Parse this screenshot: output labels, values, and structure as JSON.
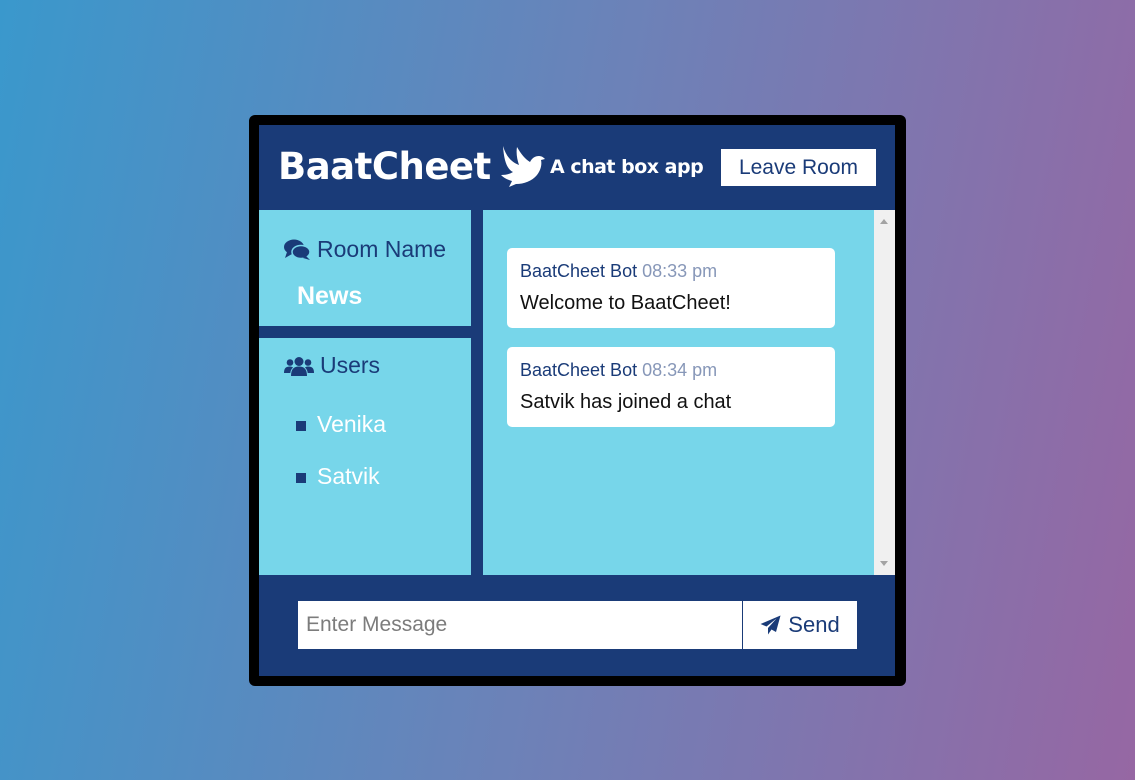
{
  "header": {
    "title": "BaatCheet",
    "logo_icon": "dove-icon",
    "tagline": "A chat box app",
    "leave_label": "Leave Room"
  },
  "sidebar": {
    "room_heading": "Room Name",
    "room_icon": "comments-icon",
    "room_name": "News",
    "users_heading": "Users",
    "users_icon": "users-icon",
    "users": [
      {
        "name": "Venika"
      },
      {
        "name": "Satvik"
      }
    ]
  },
  "messages": [
    {
      "sender": "BaatCheet Bot",
      "time": "08:33 pm",
      "text": "Welcome to BaatCheet!"
    },
    {
      "sender": "BaatCheet Bot",
      "time": "08:34 pm",
      "text": "Satvik has joined a chat"
    }
  ],
  "composer": {
    "placeholder": "Enter Message",
    "value": "",
    "send_label": "Send",
    "send_icon": "paper-plane-icon"
  },
  "colors": {
    "primary": "#1a3b78",
    "panel": "#77d6ea",
    "time": "#8797b8",
    "gradient_start": "#3a98cc",
    "gradient_end": "#9667a3"
  }
}
